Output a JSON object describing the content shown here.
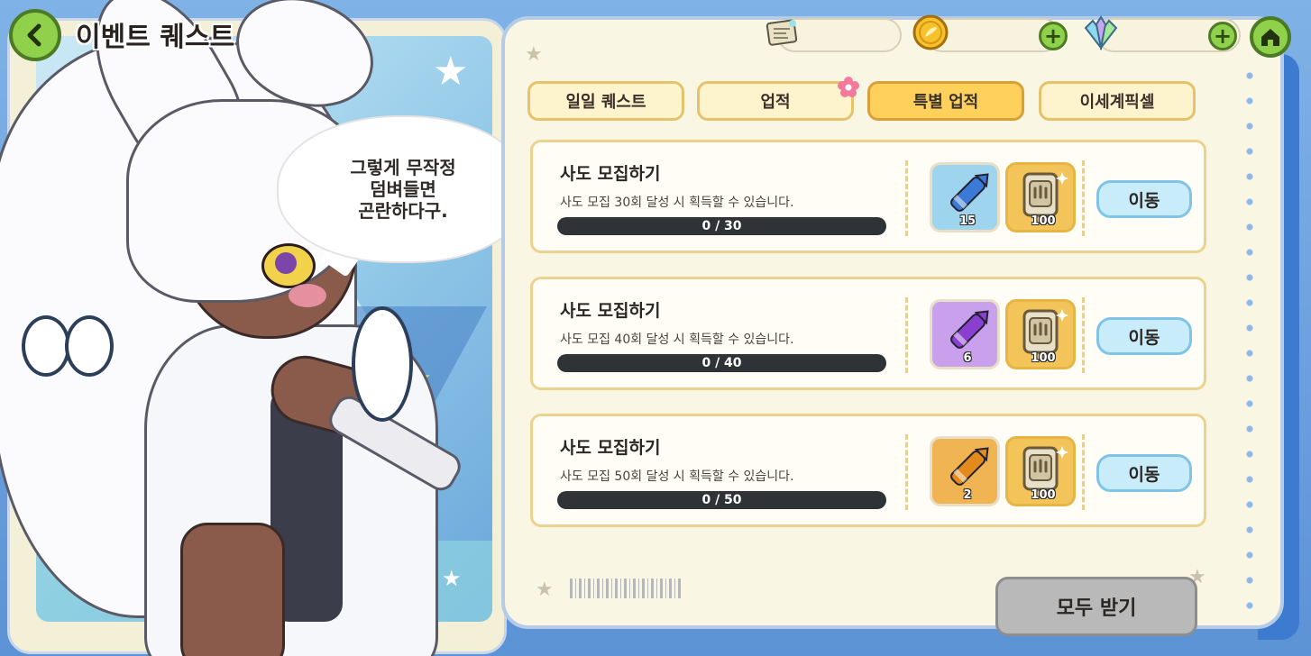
{
  "header": {
    "title": "이벤트 퀘스트",
    "back_icon": "chevron-left-icon",
    "home_icon": "home-icon"
  },
  "resources": [
    {
      "icon": "scroll-ticket-icon",
      "value": ""
    },
    {
      "icon": "gold-coin-icon",
      "value": ""
    },
    {
      "icon": "crystal-gem-icon",
      "value": ""
    }
  ],
  "speech_bubble": {
    "text": "그렇게 무작정\n덤벼들면\n곤란하다구."
  },
  "tabs": [
    {
      "label": "일일 퀘스트",
      "active": false
    },
    {
      "label": "업적",
      "active": false,
      "badge": "flower-badge-icon"
    },
    {
      "label": "특별 업적",
      "active": true
    },
    {
      "label": "이세계픽셀",
      "active": false
    }
  ],
  "quests": [
    {
      "title": "사도 모집하기",
      "description": "사도 모집 30회 달성 시 획득할 수 있습니다.",
      "progress_text": "0 / 30",
      "progress_fraction": 0,
      "rewards": [
        {
          "icon": "blue-crayon-icon",
          "count": "15",
          "color": "#9fd4ee"
        },
        {
          "icon": "gold-tablet-icon",
          "count": "100",
          "color": "#f2c45a"
        }
      ],
      "button": "이동"
    },
    {
      "title": "사도 모집하기",
      "description": "사도 모집 40회 달성 시 획득할 수 있습니다.",
      "progress_text": "0 / 40",
      "progress_fraction": 0,
      "rewards": [
        {
          "icon": "purple-crayon-icon",
          "count": "6",
          "color": "#c9a0ec"
        },
        {
          "icon": "gold-tablet-icon",
          "count": "100",
          "color": "#f2c45a"
        }
      ],
      "button": "이동"
    },
    {
      "title": "사도 모집하기",
      "description": "사도 모집 50회 달성 시 획득할 수 있습니다.",
      "progress_text": "0 / 50",
      "progress_fraction": 0,
      "rewards": [
        {
          "icon": "orange-crayon-icon",
          "count": "2",
          "color": "#f0b452"
        },
        {
          "icon": "gold-tablet-icon",
          "count": "100",
          "color": "#f2c45a"
        }
      ],
      "button": "이동"
    }
  ],
  "claim_all_label": "모두 받기",
  "colors": {
    "tab_active": "#ffd15c",
    "tab_inactive": "#fdf3cc",
    "go_button": "#c9ecfb",
    "claim_disabled": "#b9b9b9",
    "accent_green": "#8fd14b"
  }
}
